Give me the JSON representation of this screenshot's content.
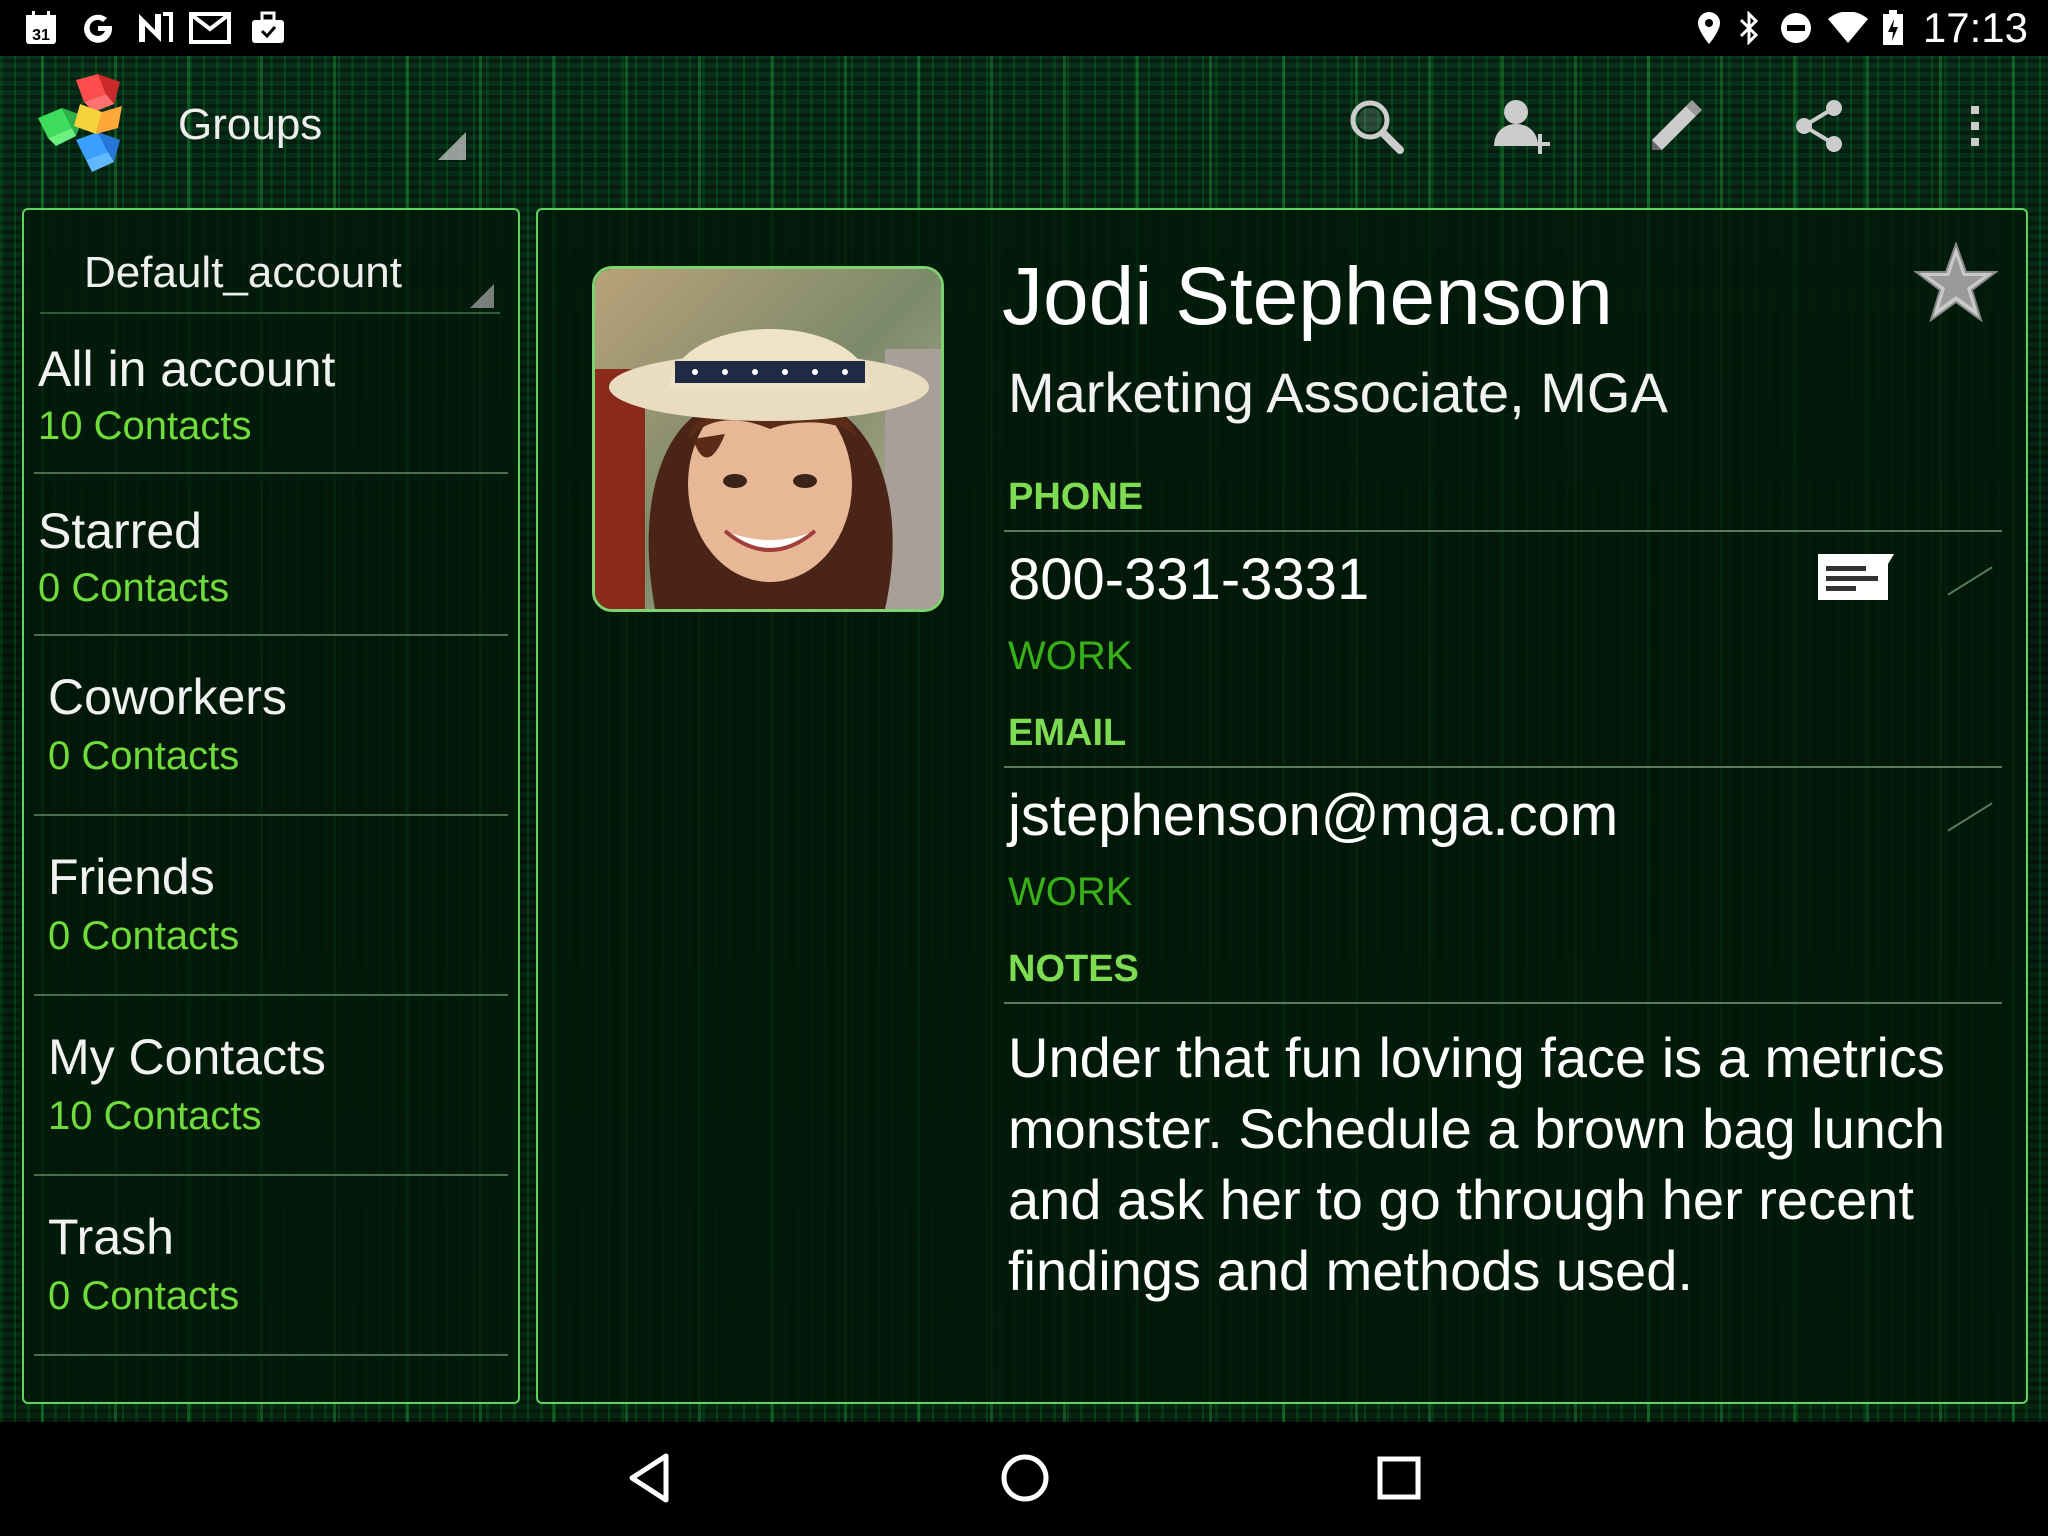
{
  "status_bar": {
    "time": "17:13",
    "left_icons": [
      "calendar-icon",
      "google-icon",
      "nfc-icon",
      "gmail-icon",
      "briefcase-icon"
    ],
    "right_icons": [
      "location-icon",
      "bluetooth-icon",
      "do-not-disturb-icon",
      "wifi-icon",
      "battery-icon"
    ],
    "calendar_day": "31"
  },
  "action_bar": {
    "groups_label": "Groups",
    "actions": [
      "search",
      "add-contact",
      "edit",
      "share",
      "overflow-menu"
    ]
  },
  "left_panel": {
    "account": "Default_account",
    "groups": [
      {
        "name": "All in account",
        "count": "10 Contacts"
      },
      {
        "name": "Starred",
        "count": "0 Contacts"
      },
      {
        "name": "Coworkers",
        "count": "0 Contacts"
      },
      {
        "name": "Friends",
        "count": "0 Contacts"
      },
      {
        "name": "My Contacts",
        "count": "10 Contacts"
      },
      {
        "name": "Trash",
        "count": "0 Contacts"
      }
    ]
  },
  "contact": {
    "name": "Jodi Stephenson",
    "title": "Marketing Associate, MGA",
    "starred": false,
    "phone_header": "PHONE",
    "phone": {
      "value": "800-331-3331",
      "type": "WORK"
    },
    "email_header": "EMAIL",
    "email": {
      "value": "jstephenson@mga.com",
      "type": "WORK"
    },
    "notes_header": "NOTES",
    "notes": "Under that fun loving face is a metrics monster.  Schedule a brown bag lunch and ask her to go through her recent findings and methods used."
  },
  "colors": {
    "panel_border": "#5fd35f",
    "accent_green": "#7ddc52",
    "type_green": "#38b018",
    "count_green": "#6fdc3c"
  },
  "nav_bar": {
    "buttons": [
      "back",
      "home",
      "recents"
    ]
  }
}
